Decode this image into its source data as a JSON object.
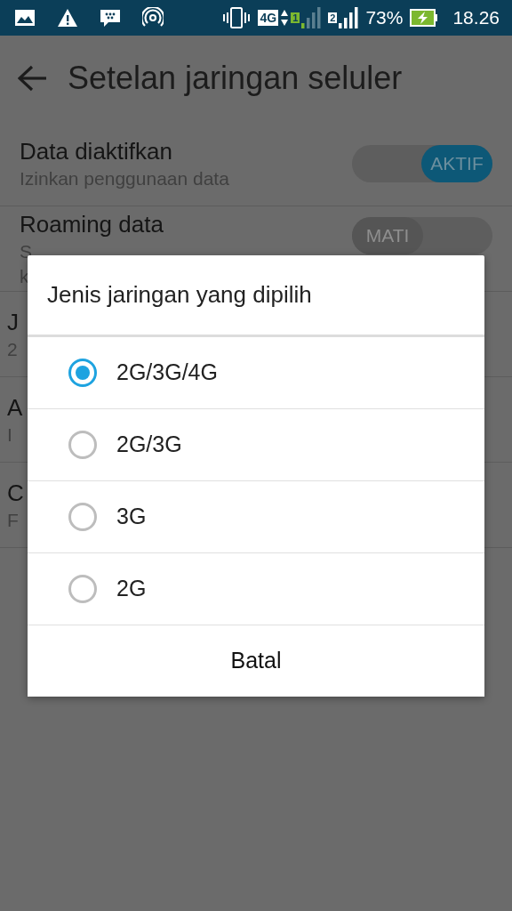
{
  "status_bar": {
    "network_badge": "4G",
    "sim_1": "1",
    "sim_2": "2",
    "battery": "73%",
    "time": "18.26"
  },
  "header": {
    "title": "Setelan jaringan seluler"
  },
  "settings": [
    {
      "title": "Data diaktifkan",
      "subtitle": "Izinkan penggunaan data",
      "kind": "toggle",
      "on": true,
      "toggle_label": "AKTIF"
    },
    {
      "title": "Roaming data",
      "subtitle": "S",
      "subtitle_2": "k",
      "kind": "toggle",
      "on": false,
      "toggle_label": "MATI"
    },
    {
      "title": "J",
      "subtitle": "2",
      "kind": "plain"
    },
    {
      "title": "A",
      "subtitle": "I",
      "kind": "plain"
    },
    {
      "title": "C",
      "subtitle": "F",
      "kind": "plain"
    }
  ],
  "dialog": {
    "title": "Jenis jaringan yang dipilih",
    "options": [
      {
        "label": "2G/3G/4G",
        "selected": true
      },
      {
        "label": "2G/3G",
        "selected": false
      },
      {
        "label": "3G",
        "selected": false
      },
      {
        "label": "2G",
        "selected": false
      }
    ],
    "cancel": "Batal"
  }
}
